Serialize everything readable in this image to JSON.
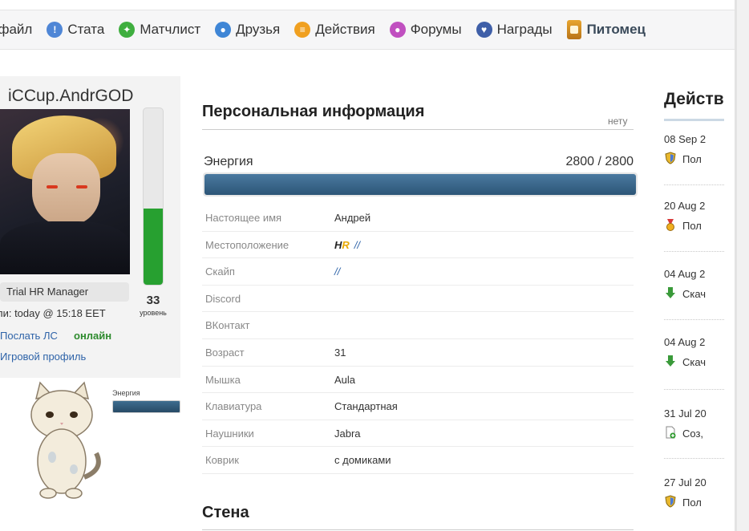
{
  "nav": {
    "items": [
      {
        "label": "офайл",
        "icon": "profile-icon",
        "color": "#4f86d6"
      },
      {
        "label": "Стата",
        "icon": "stats-icon",
        "color": "#4f86d6"
      },
      {
        "label": "Матчлист",
        "icon": "matchlist-icon",
        "color": "#3fae3f"
      },
      {
        "label": "Друзья",
        "icon": "friends-icon",
        "color": "#3f86d6"
      },
      {
        "label": "Действия",
        "icon": "actions-icon",
        "color": "#f0a020"
      },
      {
        "label": "Форумы",
        "icon": "forums-icon",
        "color": "#c050c0"
      },
      {
        "label": "Награды",
        "icon": "awards-icon",
        "color": "#3f5fa8"
      },
      {
        "label": "Питомец",
        "icon": "pet-icon",
        "color": "#e39a2a"
      }
    ]
  },
  "profile": {
    "username": "iCCup.AndrGOD",
    "rank": "Trial HR Manager",
    "level": "33",
    "level_caption": "уровень",
    "level_fill": 0.43,
    "last_seen": "ли: today @ 15:18 EET",
    "send_pm": "Послать ЛС",
    "status": "онлайн",
    "game_profile": "Игровой профиль"
  },
  "pet": {
    "energy_label": "Энергия",
    "energy_fill": 1.0
  },
  "personal": {
    "title": "Персональная информация",
    "none_text": "нету",
    "energy_label": "Энергия",
    "energy_value": "2800 / 2800",
    "energy_fill": 1.0,
    "rows": [
      {
        "key": "Настоящее имя",
        "value": "Андрей"
      },
      {
        "key": "Местоположение",
        "value": "//"
      },
      {
        "key": "Скайп",
        "value": "//"
      },
      {
        "key": "Discord",
        "value": ""
      },
      {
        "key": "ВКонтакт",
        "value": ""
      },
      {
        "key": "Возраст",
        "value": "31"
      },
      {
        "key": "Мышка",
        "value": "Aula"
      },
      {
        "key": "Клавиатура",
        "value": "Стандартная"
      },
      {
        "key": "Наушники",
        "value": "Jabra"
      },
      {
        "key": "Коврик",
        "value": "с домиками"
      }
    ],
    "location_logo": {
      "h": "H",
      "r": "R"
    }
  },
  "wall": {
    "title": "Стена"
  },
  "activity": {
    "title": "Действия",
    "items": [
      {
        "date": "08 Sep 2",
        "text": "Пол",
        "icon": "shield-icon"
      },
      {
        "date": "20 Aug 2",
        "text": "Пол",
        "icon": "medal-icon"
      },
      {
        "date": "04 Aug 2",
        "text": "Скач",
        "icon": "download-icon"
      },
      {
        "date": "04 Aug 2",
        "text": "Скач",
        "icon": "download-icon"
      },
      {
        "date": "31 Jul 20",
        "text": "Соз,",
        "icon": "new-file-icon"
      },
      {
        "date": "27 Jul 20",
        "text": "Пол",
        "icon": "shield-icon"
      }
    ]
  }
}
